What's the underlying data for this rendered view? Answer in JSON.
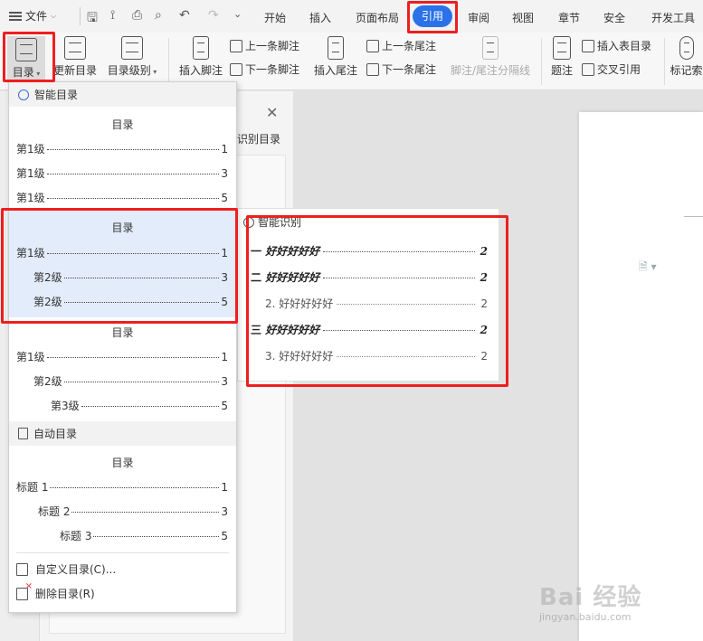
{
  "topbar": {
    "file_menu": "文件",
    "tabs": [
      "开始",
      "插入",
      "页面布局",
      "引用",
      "审阅",
      "视图",
      "章节",
      "安全",
      "开发工具"
    ],
    "active_tab": "引用"
  },
  "ribbon": {
    "toc_label": "目录",
    "update_toc": "更新目录",
    "toc_level": "目录级别",
    "insert_footnote": "插入脚注",
    "prev_footnote": "上一条脚注",
    "next_footnote": "下一条脚注",
    "insert_endnote": "插入尾注",
    "prev_endnote": "上一条尾注",
    "next_endnote": "下一条尾注",
    "note_separator": "脚注/尾注分隔线",
    "caption": "题注",
    "insert_table_of_figures": "插入表目录",
    "cross_reference": "交叉引用",
    "mark_index": "标记索"
  },
  "nav_pane": {
    "title": "识别目录"
  },
  "dropdown": {
    "smart_header": "智能目录",
    "templates": [
      {
        "title": "目录",
        "rows": [
          {
            "label": "第1级",
            "page": "1"
          },
          {
            "label": "第1级",
            "page": "3"
          },
          {
            "label": "第1级",
            "page": "5"
          }
        ]
      },
      {
        "title": "目录",
        "rows": [
          {
            "label": "第1级",
            "page": "1"
          },
          {
            "label": "第2级",
            "page": "3"
          },
          {
            "label": "第2级",
            "page": "5"
          }
        ]
      },
      {
        "title": "目录",
        "rows": [
          {
            "label": "第1级",
            "page": "1"
          },
          {
            "label": "第2级",
            "page": "3"
          },
          {
            "label": "第3级",
            "page": "5"
          }
        ]
      }
    ],
    "auto_header": "自动目录",
    "auto_template": {
      "title": "目录",
      "rows": [
        {
          "label": "标题 1",
          "page": "1"
        },
        {
          "label": "标题 2",
          "page": "3"
        },
        {
          "label": "标题 3",
          "page": "5"
        }
      ]
    },
    "custom_toc": "自定义目录(C)...",
    "delete_toc": "删除目录(R)"
  },
  "preview": {
    "header": "智能识别",
    "rows": [
      {
        "num": "一",
        "text": "好好好好好",
        "page": "2",
        "style": "bold"
      },
      {
        "num": "二",
        "text": "好好好好好",
        "page": "2",
        "style": "bold"
      },
      {
        "num": "2.",
        "text": "好好好好好",
        "page": "2",
        "style": "light"
      },
      {
        "num": "三",
        "text": "好好好好好",
        "page": "2",
        "style": "bold"
      },
      {
        "num": "3.",
        "text": "好好好好好",
        "page": "2",
        "style": "light"
      }
    ]
  },
  "watermark": {
    "logo": "Bai 经验",
    "url": "jingyan.baidu.com"
  },
  "colors": {
    "highlight_red": "#ee1f1f",
    "active_tab_blue": "#2b72e8",
    "selected_template_bg": "#e3ecfb"
  }
}
